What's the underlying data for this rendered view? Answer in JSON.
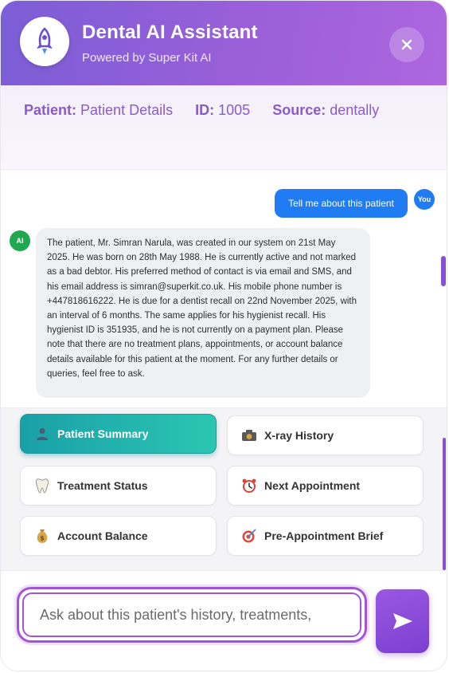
{
  "header": {
    "title": "Dental AI Assistant",
    "subtitle": "Powered by Super Kit AI",
    "logo_icon": "rocket-icon",
    "close_icon": "close-icon"
  },
  "patient_info": {
    "patient_key": "Patient:",
    "patient_value": "Patient Details",
    "id_key": "ID:",
    "id_value": "1005",
    "source_key": "Source:",
    "source_value": "dentally"
  },
  "chat": {
    "user_message": "Tell me about this patient",
    "user_avatar": "You",
    "ai_avatar": "AI",
    "ai_message": "The patient, Mr. Simran Narula, was created in our system on 21st May 2025. He was born on 28th May 1988. He is currently active and not marked as a bad debtor. His preferred method of contact is via email and SMS, and his email address is simran@superkit.co.uk. His mobile phone number is +447818616222. He is due for a dentist recall on 22nd November 2025, with an interval of 6 months. The same applies for his hygienist recall. His hygienist ID is 351935, and he is not currently on a payment plan. Please note that there are no treatment plans, appointments, or account balance details available for this patient at the moment. For any further details or queries, feel free to ask."
  },
  "quick_actions": [
    {
      "label": "Patient Summary",
      "icon": "person-icon",
      "active": true
    },
    {
      "label": "X-ray History",
      "icon": "camera-icon",
      "active": false
    },
    {
      "label": "Treatment Status",
      "icon": "tooth-icon",
      "active": false
    },
    {
      "label": "Next Appointment",
      "icon": "alarm-clock-icon",
      "active": false
    },
    {
      "label": "Account Balance",
      "icon": "money-bag-icon",
      "active": false
    },
    {
      "label": "Pre-Appointment Brief",
      "icon": "target-icon",
      "active": false
    }
  ],
  "composer": {
    "placeholder": "Ask about this patient's history, treatments,",
    "send_icon": "send-icon"
  },
  "colors": {
    "header_start": "#7b5ed6",
    "header_end": "#ad66df",
    "accent_purple": "#8a5bc7",
    "user_bubble": "#1f7cf2",
    "ai_avatar": "#1fa84f",
    "active_action": "#1aa0a8"
  }
}
